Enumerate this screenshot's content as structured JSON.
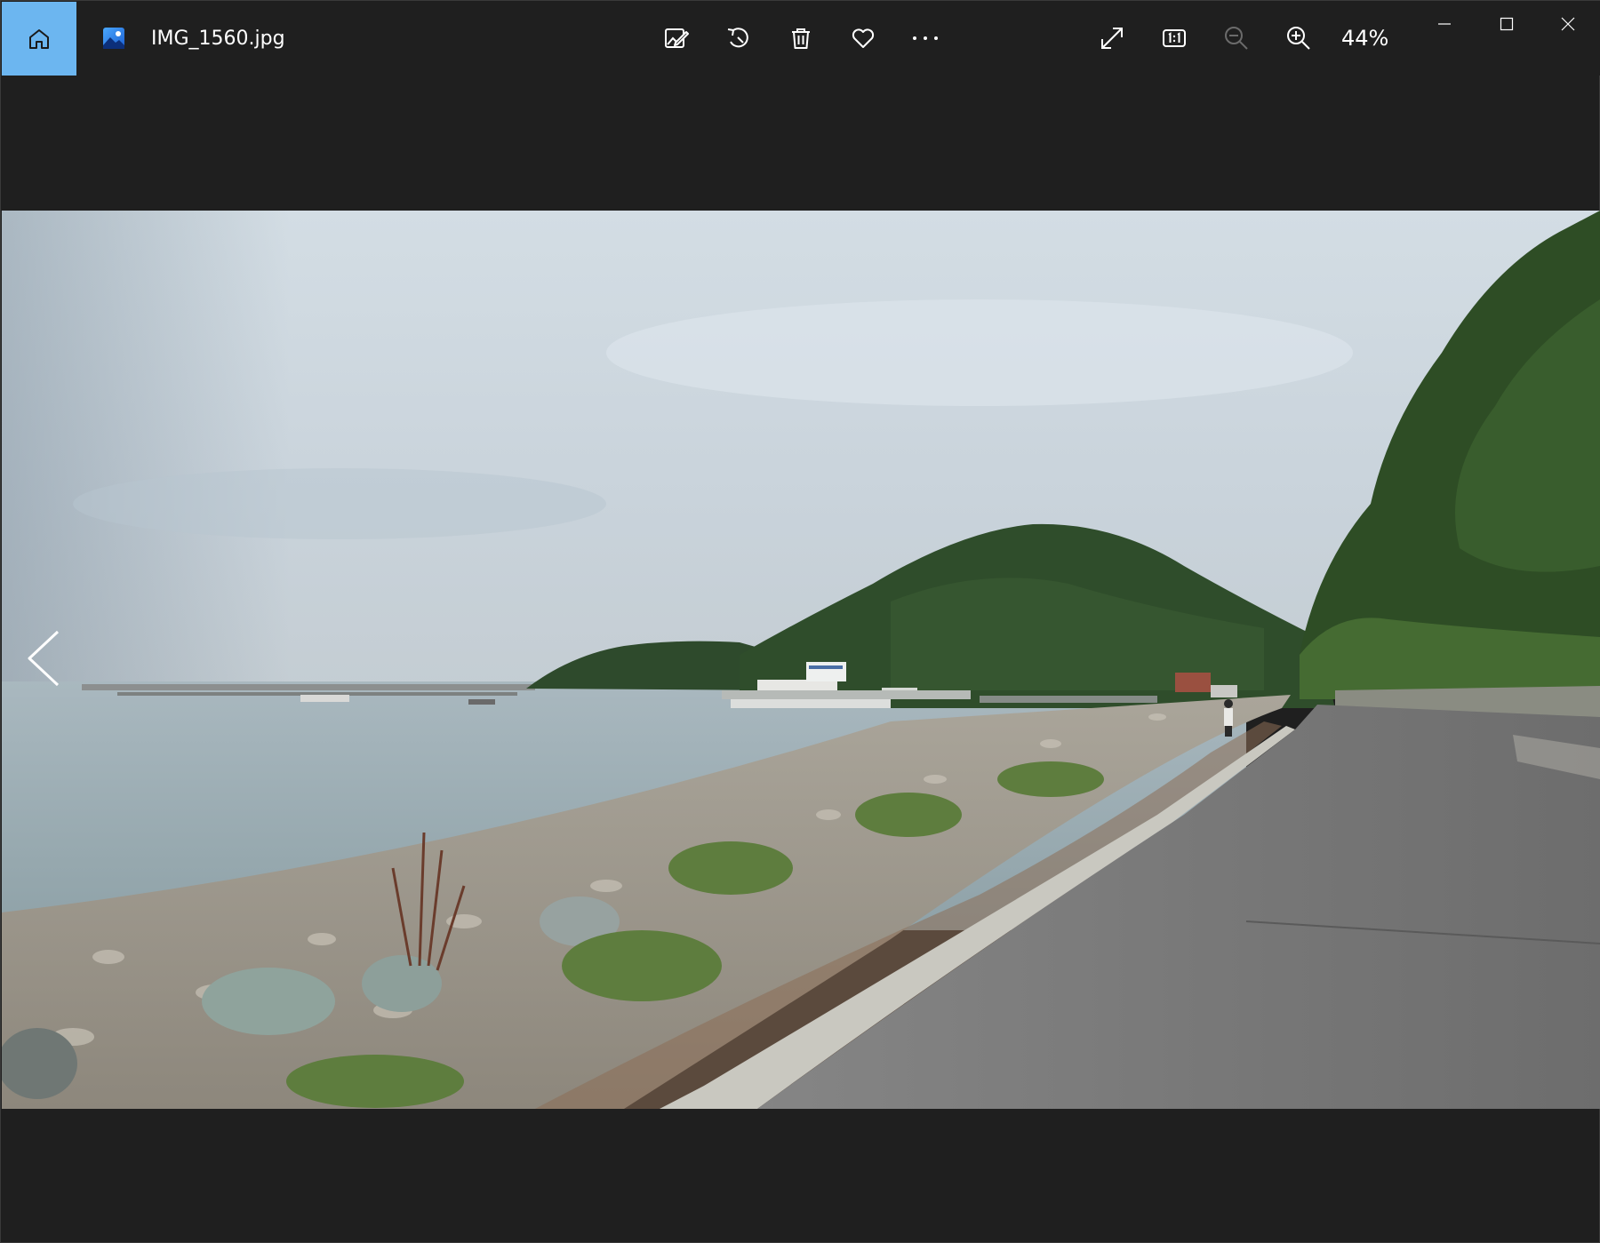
{
  "titlebar": {
    "filename": "IMG_1560.jpg",
    "zoom_level": "44%"
  },
  "icons": {
    "home": "home-icon",
    "app": "photos-app-icon",
    "edit": "edit-image-icon",
    "rotate": "rotate-icon",
    "delete": "trash-icon",
    "favorite": "heart-icon",
    "more": "more-icon",
    "fit": "expand-icon",
    "actual_size": "actual-size-icon",
    "zoom_out": "zoom-out-icon",
    "zoom_in": "zoom-in-icon",
    "minimize": "minimize-icon",
    "maximize": "maximize-icon",
    "close": "close-icon",
    "previous": "chevron-left-icon"
  },
  "colors": {
    "background": "#1f1f1f",
    "home_accent": "#6cb6f0",
    "icon": "#ffffff",
    "icon_disabled": "#6b6b6b"
  }
}
